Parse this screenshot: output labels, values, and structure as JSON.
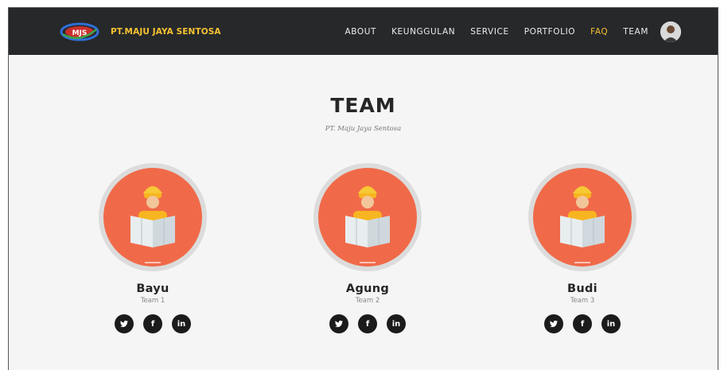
{
  "brand": {
    "name": "PT.MAJU JAYA SENTOSA",
    "logo_text": "MJS"
  },
  "nav": {
    "items": [
      {
        "label": "ABOUT"
      },
      {
        "label": "KEUNGGULAN"
      },
      {
        "label": "SERVICE"
      },
      {
        "label": "PORTFOLIO"
      },
      {
        "label": "FAQ",
        "active": true
      },
      {
        "label": "TEAM"
      }
    ],
    "accent": "#f6c233"
  },
  "team": {
    "title": "TEAM",
    "subtitle": "PT. Maju Jaya Sentosa",
    "members": [
      {
        "name": "Bayu",
        "role": "Team 1"
      },
      {
        "name": "Agung",
        "role": "Team 2"
      },
      {
        "name": "Budi",
        "role": "Team 3"
      }
    ],
    "social_icons": [
      "twitter-icon",
      "facebook-icon",
      "linkedin-icon"
    ],
    "social_glyphs": {
      "facebook": "f",
      "linkedin": "in"
    },
    "photo_bg_color": "#f06a49"
  }
}
